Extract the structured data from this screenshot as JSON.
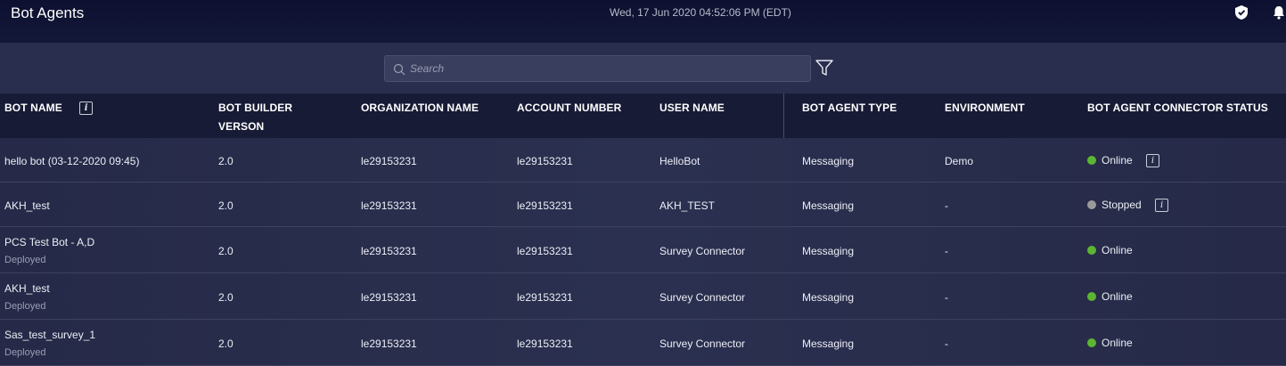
{
  "header": {
    "title": "Bot Agents",
    "datetime": "Wed, 17 Jun 2020 04:52:06 PM (EDT)"
  },
  "search": {
    "placeholder": "Search"
  },
  "columns": [
    "BOT NAME",
    "BOT BUILDER VERSON",
    "ORGANIZATION NAME",
    "ACCOUNT NUMBER",
    "USER NAME",
    "BOT AGENT TYPE",
    "ENVIRONMENT",
    "BOT AGENT CONNECTOR STATUS"
  ],
  "columns_split": {
    "builder_line1": "BOT BUILDER",
    "builder_line2": "VERSON"
  },
  "rows": [
    {
      "bot_name": "hello bot (03-12-2020 09:45)",
      "sub": "",
      "version": "2.0",
      "org": "le29153231",
      "account": "le29153231",
      "user": "HelloBot",
      "type": "Messaging",
      "env": "Demo",
      "status": "Online",
      "status_color": "#5cb531",
      "info": true
    },
    {
      "bot_name": "AKH_test",
      "sub": "",
      "version": "2.0",
      "org": "le29153231",
      "account": "le29153231",
      "user": "AKH_TEST",
      "type": "Messaging",
      "env": "-",
      "status": "Stopped",
      "status_color": "#9a9a9a",
      "info": true
    },
    {
      "bot_name": "PCS Test Bot - A,D",
      "sub": "Deployed",
      "version": "2.0",
      "org": "le29153231",
      "account": "le29153231",
      "user": "Survey Connector",
      "type": "Messaging",
      "env": "-",
      "status": "Online",
      "status_color": "#5cb531",
      "info": false
    },
    {
      "bot_name": "AKH_test",
      "sub": "Deployed",
      "version": "2.0",
      "org": "le29153231",
      "account": "le29153231",
      "user": "Survey Connector",
      "type": "Messaging",
      "env": "-",
      "status": "Online",
      "status_color": "#5cb531",
      "info": false
    },
    {
      "bot_name": "Sas_test_survey_1",
      "sub": "Deployed",
      "version": "2.0",
      "org": "le29153231",
      "account": "le29153231",
      "user": "Survey Connector",
      "type": "Messaging",
      "env": "-",
      "status": "Online",
      "status_color": "#5cb531",
      "info": false
    }
  ],
  "icons": {
    "shield": "shield-icon",
    "bell": "bell-icon",
    "search": "search-icon",
    "filter": "filter-icon",
    "info": "info-icon"
  },
  "colors": {
    "online": "#5cb531",
    "stopped": "#9a9a9a"
  }
}
